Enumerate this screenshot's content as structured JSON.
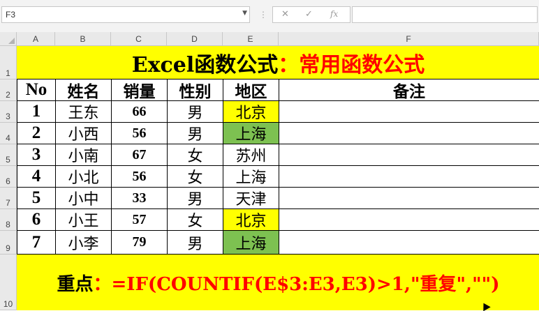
{
  "formula_bar": {
    "name_box": "F3",
    "formula_value": "",
    "cancel_icon": "✕",
    "enter_icon": "✓",
    "fx_icon": "fx"
  },
  "columns": [
    "A",
    "B",
    "C",
    "D",
    "E",
    "F"
  ],
  "rows": [
    "1",
    "2",
    "3",
    "4",
    "5",
    "6",
    "7",
    "8",
    "9",
    "10"
  ],
  "title": {
    "part1": "Excel函数公式",
    "part2": "：常用函数公式"
  },
  "table": {
    "headers": [
      "No",
      "姓名",
      "销量",
      "性别",
      "地区",
      "备注"
    ],
    "data": [
      [
        "1",
        "王东",
        "66",
        "男",
        "北京",
        ""
      ],
      [
        "2",
        "小西",
        "56",
        "男",
        "上海",
        ""
      ],
      [
        "3",
        "小南",
        "67",
        "女",
        "苏州",
        ""
      ],
      [
        "4",
        "小北",
        "56",
        "女",
        "上海",
        ""
      ],
      [
        "5",
        "小中",
        "33",
        "男",
        "天津",
        ""
      ],
      [
        "6",
        "小王",
        "57",
        "女",
        "北京",
        ""
      ],
      [
        "7",
        "小李",
        "79",
        "男",
        "上海",
        ""
      ]
    ]
  },
  "formula_note": {
    "label": "重点",
    "formula": "：=IF(COUNTIF(E$3:E3,E3)>1,\"重复\",\"\")"
  },
  "colors": {
    "yellow": "#ffff00",
    "green": "#7dc151",
    "red": "#ff0000"
  }
}
